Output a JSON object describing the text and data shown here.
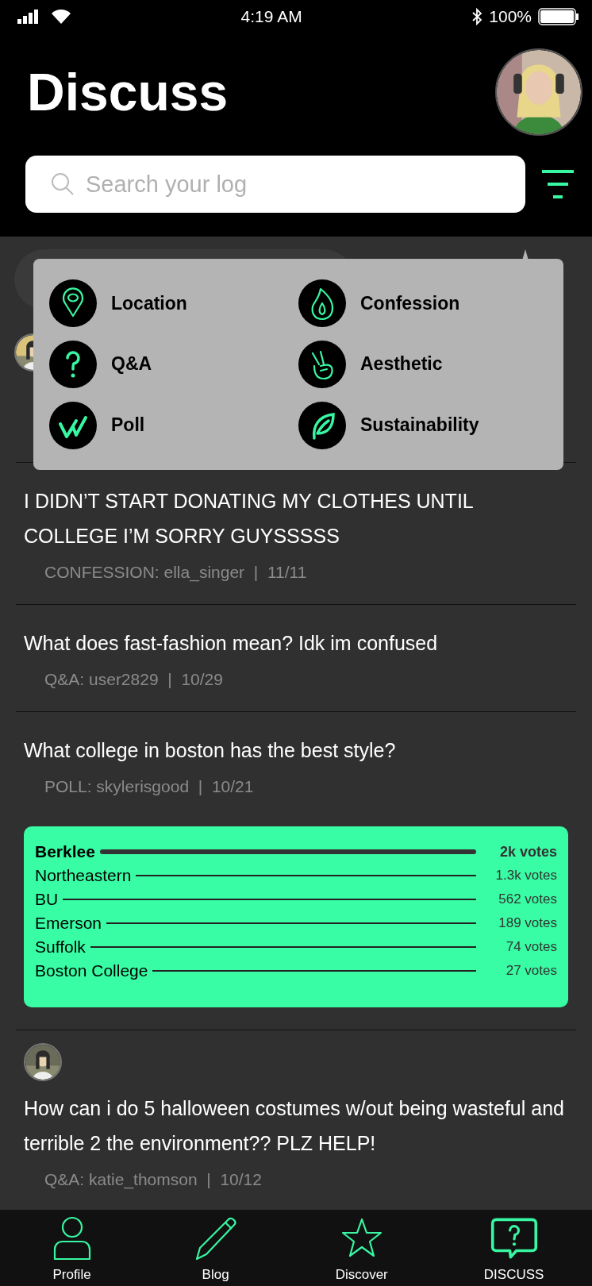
{
  "status_bar": {
    "time": "4:19 AM",
    "battery": "100%"
  },
  "header": {
    "title": "Discuss"
  },
  "search": {
    "placeholder": "Search your log"
  },
  "filter_menu": {
    "items": [
      {
        "label": "Location",
        "kind": "location"
      },
      {
        "label": "Confession",
        "kind": "confession"
      },
      {
        "label": "Q&A",
        "kind": "qa"
      },
      {
        "label": "Aesthetic",
        "kind": "aesthetic"
      },
      {
        "label": "Poll",
        "kind": "poll"
      },
      {
        "label": "Sustainability",
        "kind": "sustainability"
      }
    ]
  },
  "posts": [
    {
      "kind": "covered"
    },
    {
      "title": "I DIDN’T START DONATING MY CLOTHES UNTIL COLLEGE I’M SORRY GUYSSSSS",
      "meta": "CONFESSION: ella_singer  |  11/11"
    },
    {
      "title": "What does fast-fashion mean? Idk im confused",
      "meta": "Q&A: user2829  |  10/29"
    },
    {
      "title": "What college in boston has the best style?",
      "meta": "POLL: skylerisgood  |  10/21",
      "poll": [
        {
          "option": "Berklee",
          "votes": "2k votes",
          "selected": true
        },
        {
          "option": "Northeastern",
          "votes": "1.3k votes",
          "selected": false
        },
        {
          "option": "BU",
          "votes": "562 votes",
          "selected": false
        },
        {
          "option": "Emerson",
          "votes": "189 votes",
          "selected": false
        },
        {
          "option": "Suffolk",
          "votes": "74 votes",
          "selected": false
        },
        {
          "option": "Boston College",
          "votes": "27 votes",
          "selected": false
        }
      ]
    },
    {
      "kind": "with_avatar",
      "title": "How can i do 5 halloween costumes w/out being wasteful and terrible 2 the environment?? PLZ HELP!",
      "meta": "Q&A: katie_thomson  |  10/12"
    }
  ],
  "tabs": [
    {
      "label": "Profile",
      "kind": "profile",
      "selected": false
    },
    {
      "label": "Blog",
      "kind": "blog",
      "selected": false
    },
    {
      "label": "Discover",
      "kind": "discover",
      "selected": false
    },
    {
      "label": "DISCUSS",
      "kind": "discuss",
      "selected": true
    }
  ]
}
